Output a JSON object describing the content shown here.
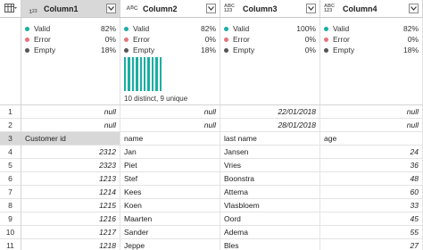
{
  "colors": {
    "valid": "#1aaea3",
    "error": "#e8737a",
    "empty": "#555555"
  },
  "columns": [
    {
      "name": "Column1",
      "type_icon": "123",
      "type_label": "1²2³",
      "quality": {
        "valid": "82%",
        "error": "0%",
        "empty": "18%"
      }
    },
    {
      "name": "Column2",
      "type_icon": "ABC",
      "type_label": "AᴮC",
      "quality": {
        "valid": "82%",
        "error": "0%",
        "empty": "18%"
      },
      "distribution": "10 distinct, 9 unique"
    },
    {
      "name": "Column3",
      "type_icon": "ABC123",
      "type_label": "ABC 123",
      "quality": {
        "valid": "100%",
        "error": "0%",
        "empty": "0%"
      }
    },
    {
      "name": "Column4",
      "type_icon": "ABC123",
      "type_label": "ABC 123",
      "quality": {
        "valid": "82%",
        "error": "0%",
        "empty": "18%"
      }
    }
  ],
  "labels": {
    "valid": "Valid",
    "error": "Error",
    "empty": "Empty"
  },
  "rows": [
    {
      "n": "1",
      "c1": "null",
      "c2": "null",
      "c3": "22/01/2018",
      "c4": "null"
    },
    {
      "n": "2",
      "c1": "null",
      "c2": "null",
      "c3": "28/01/2018",
      "c4": "null"
    },
    {
      "n": "3",
      "c1": "Customer id",
      "c2": "name",
      "c3": "last name",
      "c4": "age"
    },
    {
      "n": "4",
      "c1": "2312",
      "c2": "Jan",
      "c3": "Jansen",
      "c4": "24"
    },
    {
      "n": "5",
      "c1": "2323",
      "c2": "Piet",
      "c3": "Vries",
      "c4": "36"
    },
    {
      "n": "6",
      "c1": "1213",
      "c2": "Stef",
      "c3": "Boonstra",
      "c4": "48"
    },
    {
      "n": "7",
      "c1": "1214",
      "c2": "Kees",
      "c3": "Attema",
      "c4": "60"
    },
    {
      "n": "8",
      "c1": "1215",
      "c2": "Koen",
      "c3": "Vlasbloem",
      "c4": "33"
    },
    {
      "n": "9",
      "c1": "1216",
      "c2": "Maarten",
      "c3": "Oord",
      "c4": "45"
    },
    {
      "n": "10",
      "c1": "1217",
      "c2": "Sander",
      "c3": "Adema",
      "c4": "55"
    },
    {
      "n": "11",
      "c1": "1218",
      "c2": "Jeppe",
      "c3": "Bles",
      "c4": "27"
    }
  ]
}
